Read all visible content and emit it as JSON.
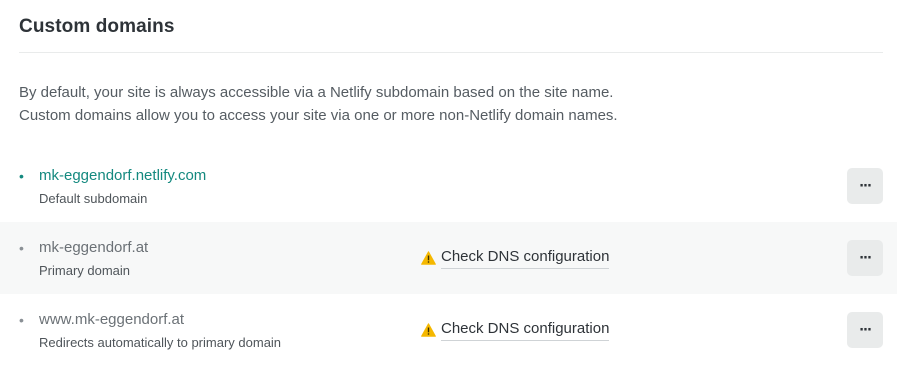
{
  "section": {
    "title": "Custom domains",
    "description_lines": [
      "By default, your site is always accessible via a Netlify subdomain based on the site name.",
      "Custom domains allow you to access your site via one or more non-Netlify domain names."
    ]
  },
  "domains": [
    {
      "bullet": "•",
      "name": "mk-eggendorf.netlify.com",
      "subtitle": "Default subdomain",
      "more_label": "···"
    },
    {
      "bullet": "•",
      "name": "mk-eggendorf.at",
      "subtitle": "Primary domain",
      "warning_icon": "warning-triangle-icon",
      "warning_text": "Check DNS configuration",
      "more_label": "···"
    },
    {
      "bullet": "•",
      "name": "www.mk-eggendorf.at",
      "subtitle": "Redirects automatically to primary domain",
      "warning_icon": "warning-triangle-icon",
      "warning_text": "Check DNS configuration",
      "more_label": "···"
    }
  ],
  "colors": {
    "accent_teal": "#14897f",
    "warning_yellow": "#f5b800",
    "row_shade": "#f7f8f8",
    "button_bg": "#e9ebeb"
  }
}
